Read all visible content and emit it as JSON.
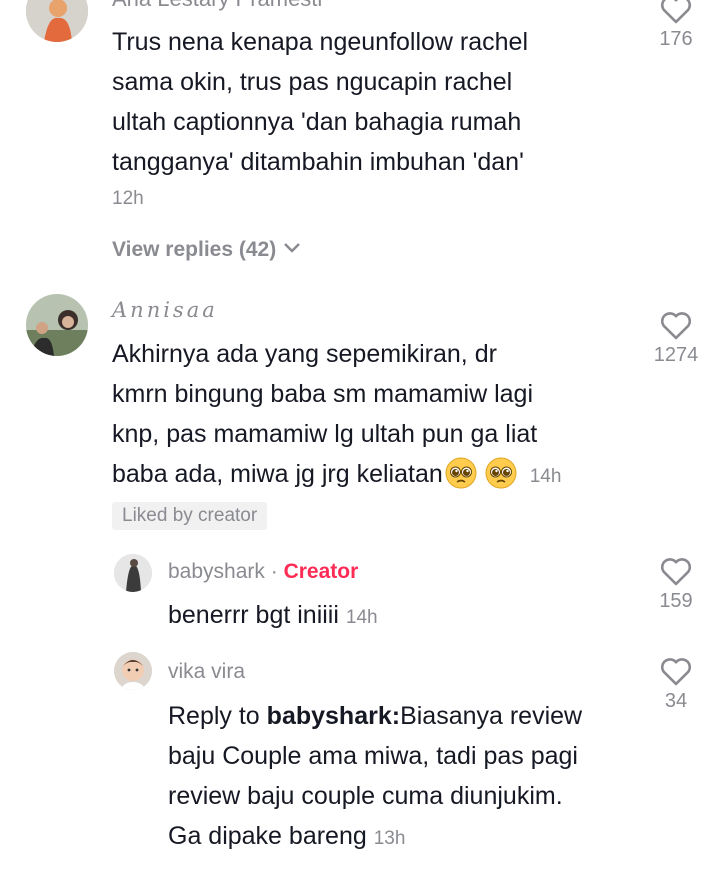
{
  "comments": [
    {
      "author": "Ana Lestary Pramesti",
      "lines": [
        "Trus nena kenapa ngeunfollow rachel",
        "sama okin, trus pas ngucapin rachel",
        "ultah captionnya 'dan bahagia rumah",
        "tangganya' ditambahin imbuhan 'dan'"
      ],
      "time": "12h",
      "likes": "176",
      "view_replies": "View replies (42)"
    },
    {
      "author": "Annisaa",
      "lines": [
        "Akhirnya ada yang sepemikiran, dr",
        "kmrn bingung baba sm mamamiw lagi",
        "knp, pas mamamiw lg ultah pun ga liat",
        "baba ada, miwa jg jrg keliatan"
      ],
      "emoji": "pleading-face-icon",
      "time": "14h",
      "likes": "1274",
      "liked_badge": "Liked by creator"
    }
  ],
  "replies": [
    {
      "author": "babyshark",
      "separator": "·",
      "creator_label": "Creator",
      "text": "benerrr bgt iniiii",
      "time": "14h",
      "likes": "159"
    },
    {
      "author": "vika vira",
      "reply_prefix": "Reply to ",
      "reply_to": "babyshark:",
      "lines": [
        "Biasanya review",
        "baju Couple ama miwa, tadi pas pagi",
        "review baju couple cuma diunjukim.",
        "Ga dipake bareng"
      ],
      "time": "13h",
      "likes": "34"
    }
  ],
  "colors": {
    "text": "#161823",
    "muted": "#8a8b91",
    "creator": "#fe2c55",
    "badge_bg": "#f1f1f2"
  }
}
